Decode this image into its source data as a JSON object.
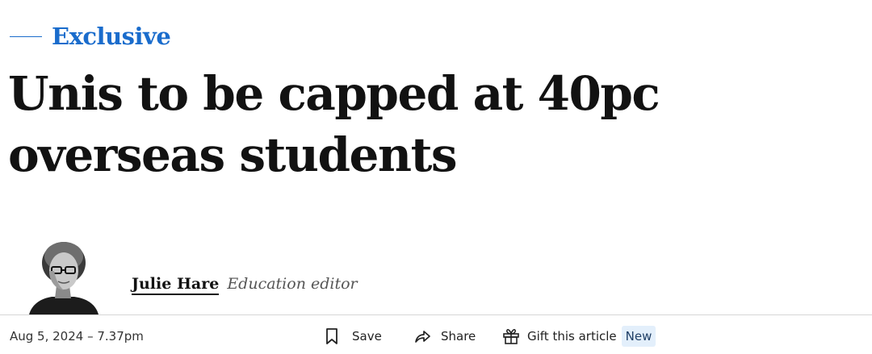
{
  "kicker": {
    "label": "Exclusive",
    "color": "#1a6ccc"
  },
  "headline": "Unis to be capped at 40pc overseas students",
  "byline": {
    "author_name": "Julie Hare",
    "author_role": "Education editor"
  },
  "article_meta": {
    "date": "Aug 5, 2024 – 7.37pm"
  },
  "actions": {
    "save_label": "Save",
    "save_icon": "bookmark-icon",
    "share_label": "Share",
    "share_icon": "share-arrow-icon",
    "gift_label": "Gift this article",
    "gift_icon": "gift-icon",
    "new_badge": "New"
  }
}
